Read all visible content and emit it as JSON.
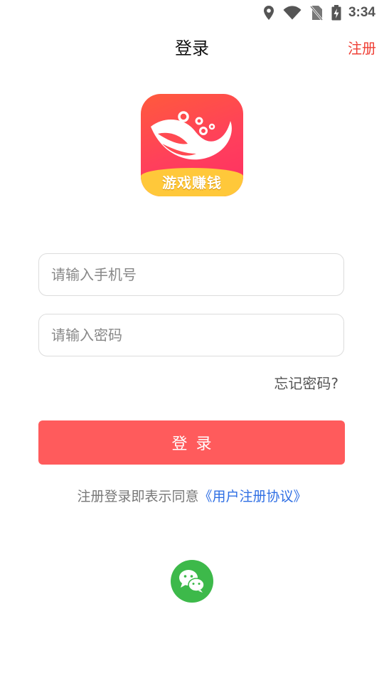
{
  "status_bar": {
    "time": "3:34",
    "icons": [
      "location-icon",
      "wifi-icon",
      "no-sim-icon",
      "battery-charging-icon"
    ]
  },
  "header": {
    "title": "登录",
    "register_label": "注册"
  },
  "logo": {
    "text": "游戏赚钱"
  },
  "form": {
    "phone_placeholder": "请输入手机号",
    "password_placeholder": "请输入密码",
    "forgot_label": "忘记密码?",
    "login_label": "登录"
  },
  "agreement": {
    "prefix": "注册登录即表示同意",
    "link_label": "《用户注册协议》"
  },
  "social": {
    "wechat_icon": "wechat-icon"
  },
  "colors": {
    "accent_red": "#ff5b5c",
    "register_red": "#ef4036",
    "link_blue": "#2f6fe4",
    "wechat_green": "#3db94a",
    "logo_yellow": "#ffc83a"
  }
}
